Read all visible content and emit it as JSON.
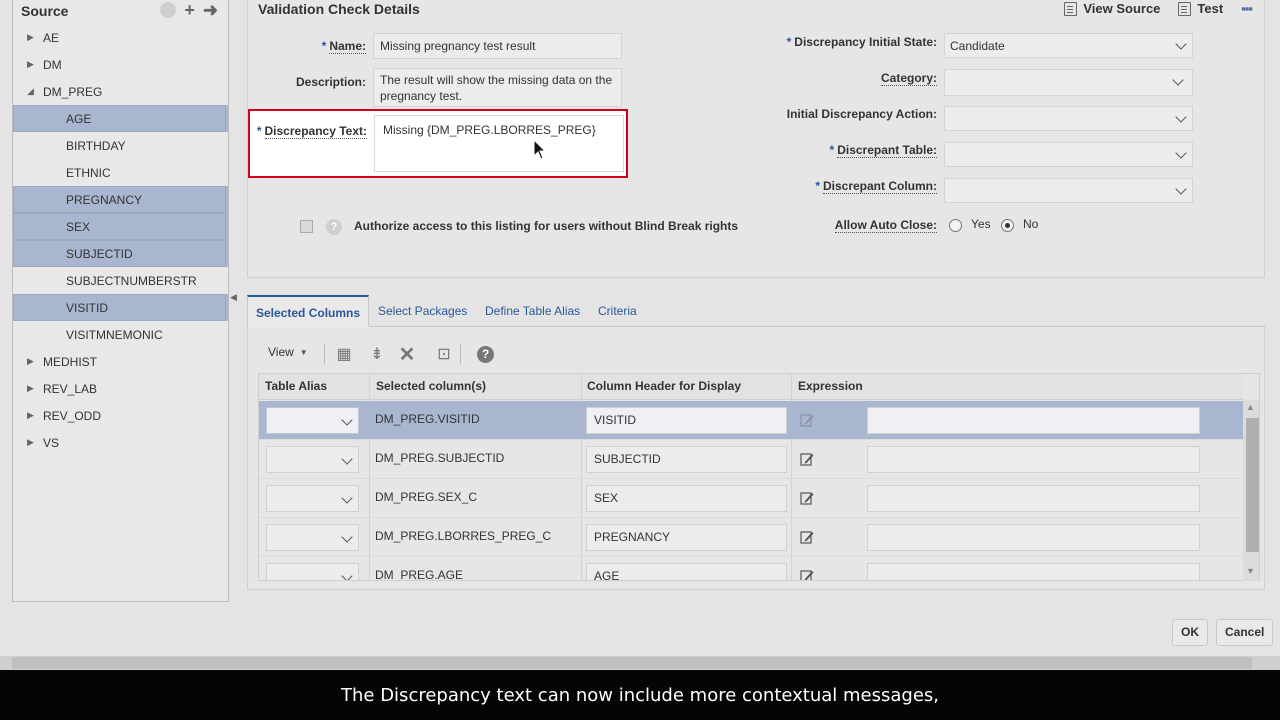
{
  "source_panel": {
    "title": "Source",
    "tree": [
      {
        "label": "AE",
        "expanded": false
      },
      {
        "label": "DM",
        "expanded": false
      },
      {
        "label": "DM_PREG",
        "expanded": true
      },
      {
        "label": "AGE",
        "child": true,
        "selected": true
      },
      {
        "label": "BIRTHDAY",
        "child": true,
        "selected": false
      },
      {
        "label": "ETHNIC",
        "child": true,
        "selected": false
      },
      {
        "label": "PREGNANCY",
        "child": true,
        "selected": true
      },
      {
        "label": "SEX",
        "child": true,
        "selected": true
      },
      {
        "label": "SUBJECTID",
        "child": true,
        "selected": true
      },
      {
        "label": "SUBJECTNUMBERSTR",
        "child": true,
        "selected": false
      },
      {
        "label": "VISITID",
        "child": true,
        "selected": true
      },
      {
        "label": "VISITMNEMONIC",
        "child": true,
        "selected": false
      },
      {
        "label": "MEDHIST",
        "expanded": false
      },
      {
        "label": "REV_LAB",
        "expanded": false
      },
      {
        "label": "REV_ODD",
        "expanded": false
      },
      {
        "label": "VS",
        "expanded": false
      }
    ]
  },
  "main": {
    "title": "Validation Check Details",
    "view_source_label": "View Source",
    "test_label": "Test",
    "more_label": "▪▪▪",
    "name_label": "Name:",
    "name_value": "Missing pregnancy test result",
    "description_label": "Description:",
    "description_value": "The result will show the missing data on the pregnancy test.",
    "disc_text_label": "Discrepancy Text:",
    "disc_text_value": "Missing {DM_PREG.LBORRES_PREG}",
    "authorize_label": "Authorize access to this listing for users without Blind Break rights",
    "disc_initial_state_label": "Discrepancy Initial State:",
    "disc_initial_state_value": "Candidate",
    "category_label": "Category:",
    "initial_action_label": "Initial Discrepancy Action:",
    "discrepant_table_label": "Discrepant Table:",
    "discrepant_column_label": "Discrepant Column:",
    "allow_auto_close_label": "Allow Auto Close:",
    "yes_label": "Yes",
    "no_label": "No",
    "auto_close_selected": "No"
  },
  "tabs": [
    {
      "label": "Selected Columns",
      "active": true
    },
    {
      "label": "Select Packages",
      "active": false
    },
    {
      "label": "Define Table Alias",
      "active": false
    },
    {
      "label": "Criteria",
      "active": false
    }
  ],
  "toolbar": {
    "view_label": "View"
  },
  "grid": {
    "headers": [
      "Table Alias",
      "Selected column(s)",
      "Column Header for Display",
      "Expression"
    ],
    "rows": [
      {
        "column": "DM_PREG.VISITID",
        "header": "VISITID",
        "selected": true
      },
      {
        "column": "DM_PREG.SUBJECTID",
        "header": "SUBJECTID",
        "selected": false
      },
      {
        "column": "DM_PREG.SEX_C",
        "header": "SEX",
        "selected": false
      },
      {
        "column": "DM_PREG.LBORRES_PREG_C",
        "header": "PREGNANCY",
        "selected": false
      },
      {
        "column": "DM_PREG.AGE",
        "header": "AGE",
        "selected": false
      }
    ]
  },
  "buttons": {
    "ok": "OK",
    "cancel": "Cancel"
  },
  "caption": "The Discrepancy text can now include more contextual messages,",
  "colors": {
    "highlight_border": "#d0021b",
    "selection": "#a8b7cf",
    "link": "#2b5797"
  }
}
